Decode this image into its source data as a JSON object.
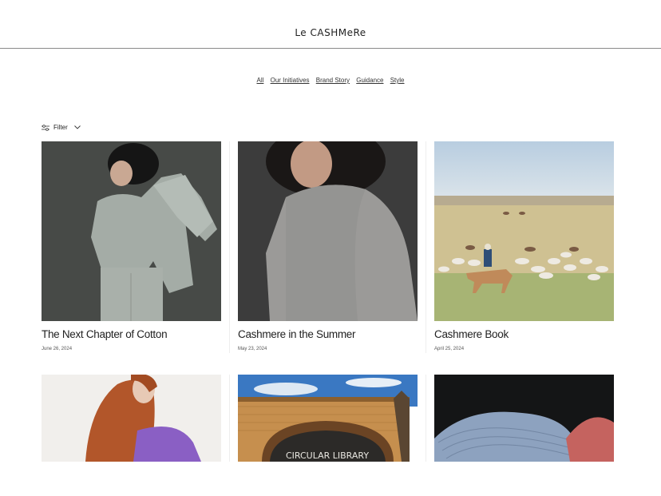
{
  "brand": {
    "logo_text": "Le CASHMeRe"
  },
  "nav": {
    "items": [
      "All",
      "Our Initiatives",
      "Brand Story",
      "Guidance",
      "Style"
    ]
  },
  "filter": {
    "label": "Filter"
  },
  "articles": [
    {
      "title": "The Next Chapter of Cotton",
      "date": "June 26, 2024"
    },
    {
      "title": "Cashmere in the Summer",
      "date": "May 23, 2024"
    },
    {
      "title": "Cashmere Book",
      "date": "April 25, 2024"
    },
    {
      "title": "",
      "date": ""
    },
    {
      "title": "",
      "date": "",
      "image_text": "CIRCULAR LIBRARY"
    },
    {
      "title": "",
      "date": ""
    }
  ]
}
